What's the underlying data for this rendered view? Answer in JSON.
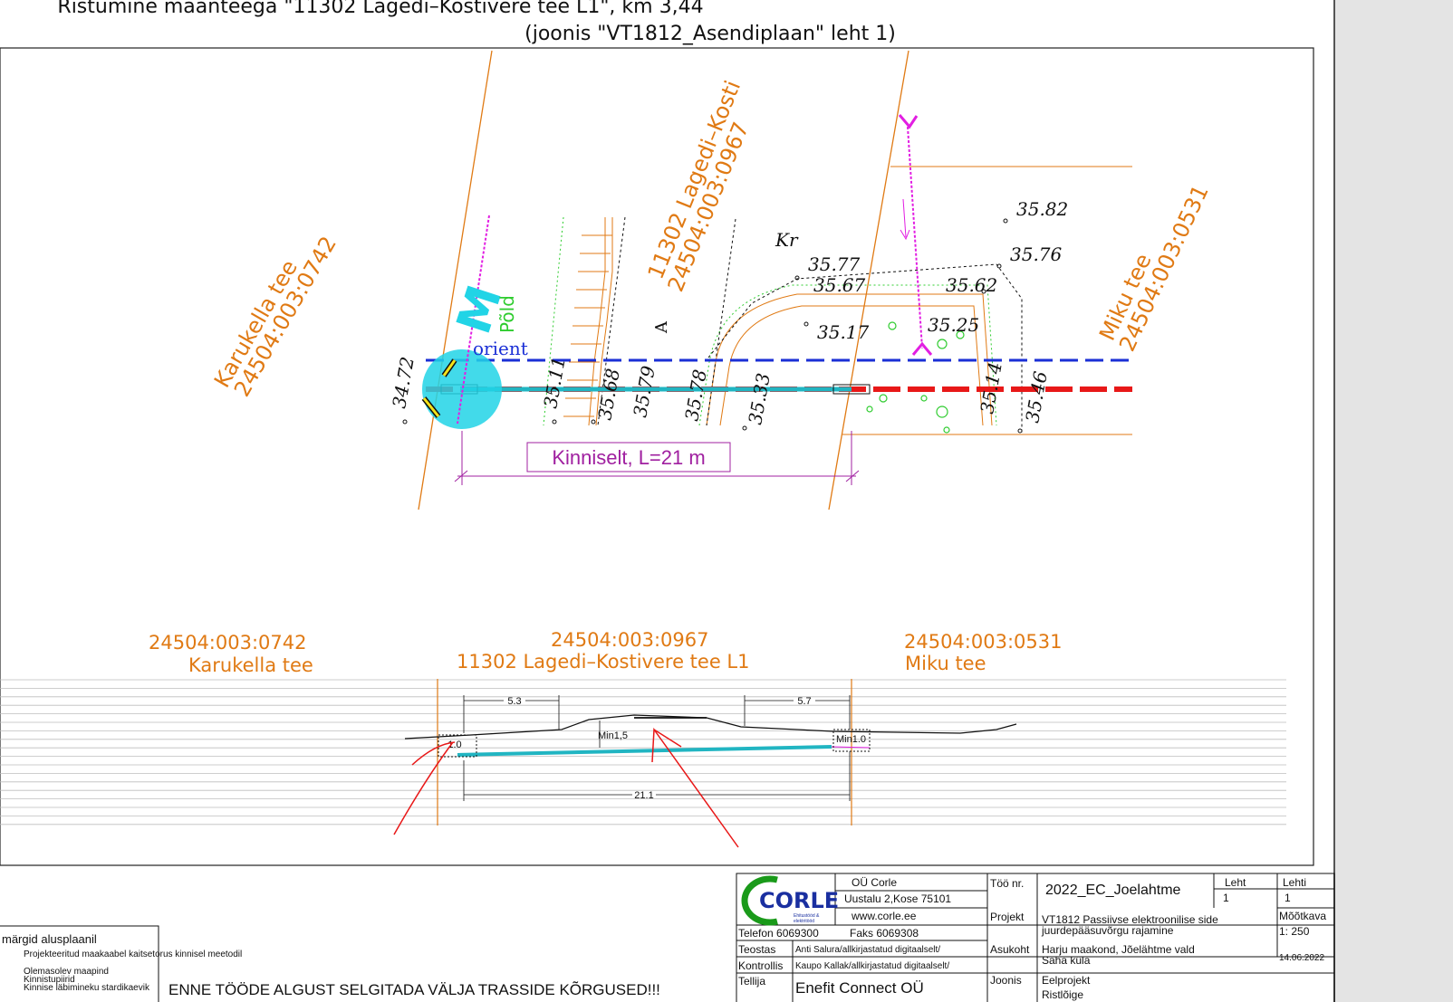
{
  "title": {
    "line1": "Ristumine maanteega \"11302 Lagedi–Kostivere tee L1\", km 3,44",
    "line2": "(joonis \"VT1812_Asendiplaan\" leht 1)"
  },
  "plan": {
    "parcel_left_name": "Karukella tee",
    "parcel_left_id": "24504:003:0742",
    "parcel_mid_name": "11302 Lagedi–Kosti",
    "parcel_mid_id": "24504:003:0967",
    "parcel_right_name": "Miku tee",
    "parcel_right_id": "24504:003:0531",
    "label_pold": "Põld",
    "label_orient": "orient",
    "label_kr": "Kr",
    "label_a": "A",
    "label_m": "M",
    "span_label": "Kinniselt, L=21 m",
    "elevations": {
      "e1": "35.82",
      "e2": "35.76",
      "e3": "35.77",
      "e4": "35.67",
      "e5": "35.62",
      "e6": "35.17",
      "e7": "35.25",
      "e8": "34.72",
      "e9": "35.11",
      "e10": "35.68",
      "e11": "35.79",
      "e12": "35.78",
      "e13": "35.33",
      "e14": "35.14",
      "e15": "35.46"
    }
  },
  "section": {
    "left_id": "24504:003:0742",
    "left_name": "Karukella tee",
    "mid_id": "24504:003:0967",
    "mid_name": "11302 Lagedi–Kostivere tee L1",
    "right_id": "24504:003:0531",
    "right_name": "Miku tee",
    "dim_left": "5.3",
    "dim_right": "5.7",
    "dim_total": "21.1",
    "min_left": "1.0",
    "min_mid": "Min1,5",
    "min_right": "Min1.0"
  },
  "legend": {
    "title": "märgid alusplaanil",
    "items": [
      "Projekteeritud maakaabel kaitsetorus kinnisel meetodil",
      "Olemasolev maapind",
      "Kinnistupiirid",
      "Kinnise läbimineku stardikaevik"
    ]
  },
  "warning": "ENNE TÖÖDE ALGUST SELGITADA VÄLJA TRASSIDE KÕRGUSED!!!",
  "title_block": {
    "logo_text": "CORLE",
    "logo_sub1": "Ehitustööd &",
    "logo_sub2": "elektritööd",
    "company": "OÜ Corle",
    "address": "Uustalu 2,Kose 75101",
    "web": "www.corle.ee",
    "phone": "Telefon 6069300",
    "fax": "Faks 6069308",
    "teostas_label": "Teostas",
    "teostas_value": "Anti Salura/allkirjastatud digitaalselt/",
    "kontrollis_label": "Kontrollis",
    "kontrollis_value": "Kaupo Kallak/allkirjastatud digitaalselt/",
    "tellija_label": "Tellija",
    "tellija_value": "Enefit Connect OÜ",
    "too_nr_label": "Töö nr.",
    "too_nr_value": "2022_EC_Joelahtme",
    "projekt_label": "Projekt",
    "projekt_value1": "VT1812 Passiivse elektroonilise side",
    "projekt_value2": "juurdepääsuvõrgu rajamine",
    "asukoht_label": "Asukoht",
    "asukoht_value1": "Harju maakond, Jõelähtme vald",
    "asukoht_value2": "Saha küla",
    "joonis_label": "Joonis",
    "joonis_value1": "Eelprojekt",
    "joonis_value2": "Ristlõige",
    "leht_label": "Leht",
    "leht_value": "1",
    "lehti_label": "Lehti",
    "lehti_value": "1",
    "mootkava_label": "Mõõtkava",
    "mootkava_value": "1: 250",
    "date": "14.06.2022"
  },
  "colors": {
    "orange": "#e07a14",
    "cyan": "#21b5c2",
    "red": "#e81818",
    "blue": "#1a2fd6",
    "magenta": "#e21ee2",
    "green": "#2fcc2f"
  }
}
